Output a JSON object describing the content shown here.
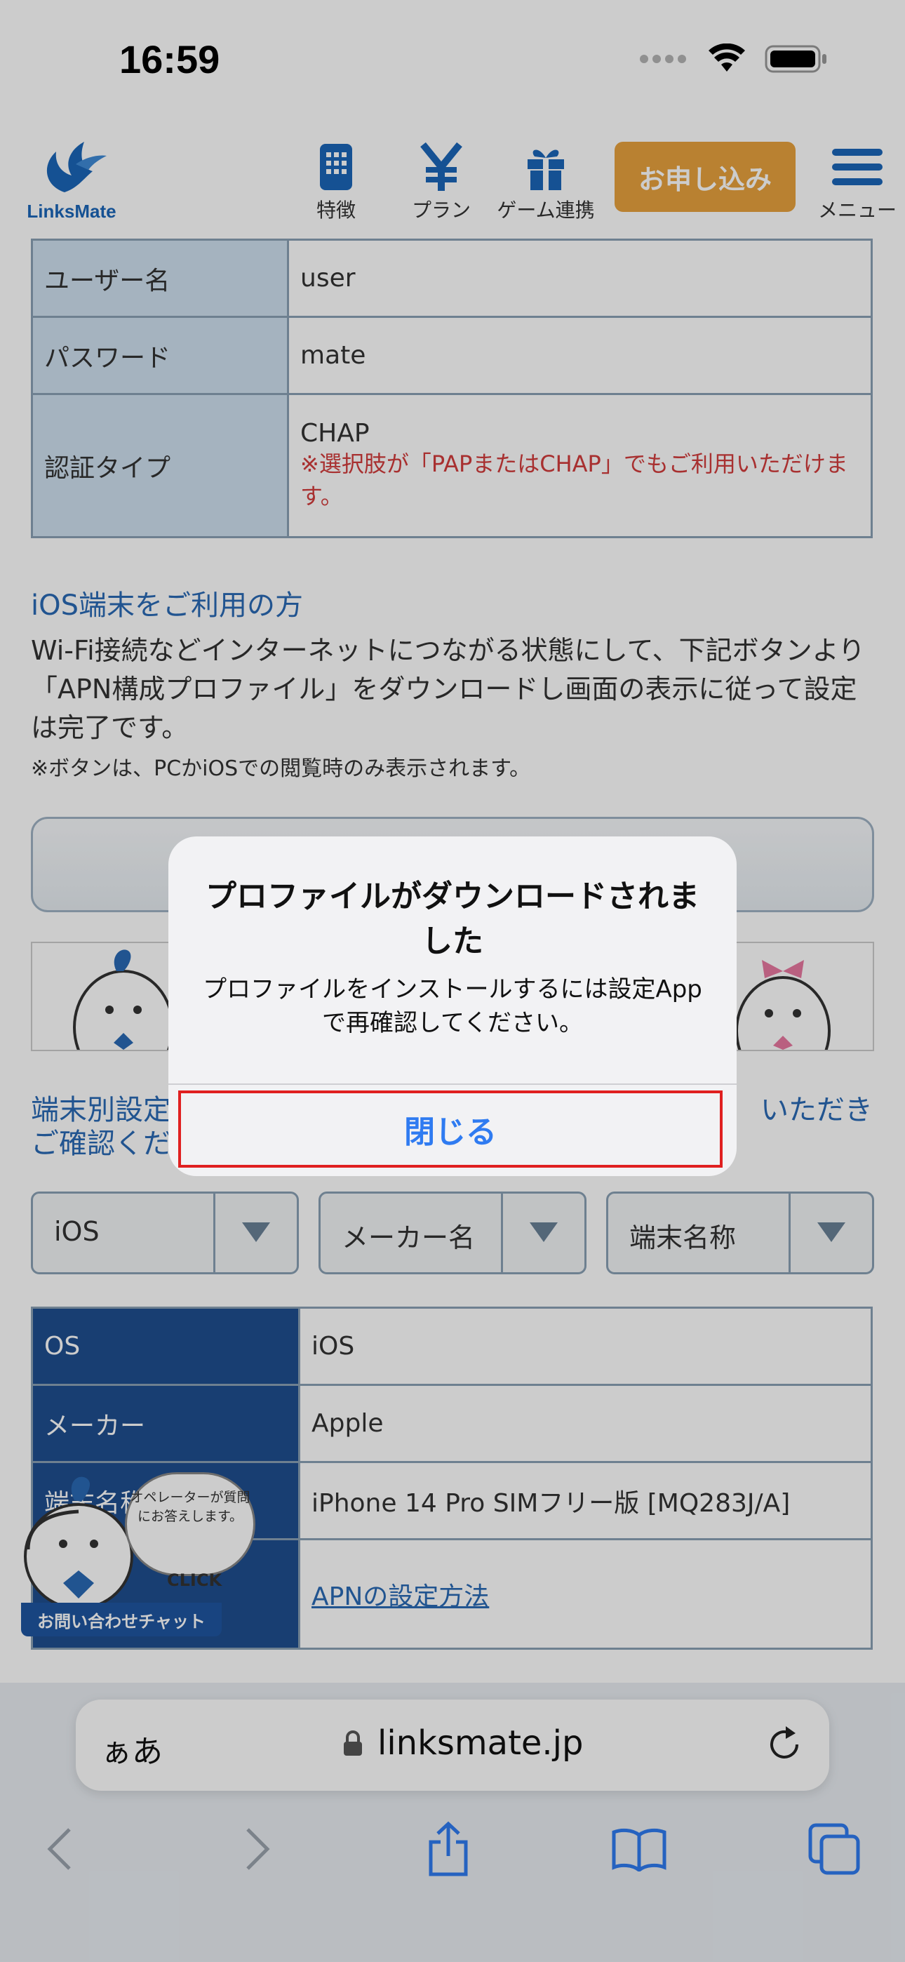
{
  "status": {
    "time": "16:59"
  },
  "header": {
    "logo_text": "LinksMate",
    "nav": [
      {
        "label": "特徴",
        "icon": "phone-icon"
      },
      {
        "label": "プラン",
        "icon": "yen-icon"
      },
      {
        "label": "ゲーム連携",
        "icon": "gift-icon"
      }
    ],
    "apply_label": "お申し込み",
    "menu_label": "メニュー"
  },
  "apn_table": {
    "rows": [
      {
        "label": "ユーザー名",
        "value": "user"
      },
      {
        "label": "パスワード",
        "value": "mate"
      },
      {
        "label": "認証タイプ",
        "value": "CHAP",
        "note": "※選択肢が「PAPまたはCHAP」でもご利用いただけます。"
      }
    ]
  },
  "ios_section": {
    "title": "iOS端末をご利用の方",
    "body": "Wi-Fi接続などインターネットにつながる状態にして、下記ボタンより「APN構成プロファイル」をダウンロードし画面の表示に従って設定は完了です。",
    "note": "※ボタンは、PCかiOSでの閲覧時のみ表示されます。"
  },
  "device_section": {
    "title_left": "端末別設定",
    "title_right": "いただき",
    "title_line2": "ご確認くだ"
  },
  "selects": [
    {
      "value": "iOS"
    },
    {
      "value": "メーカー名"
    },
    {
      "value": "端末名称"
    }
  ],
  "device_table": {
    "rows": [
      {
        "label": "OS",
        "value": "iOS"
      },
      {
        "label": "メーカー",
        "value": "Apple"
      },
      {
        "label": "端末名称",
        "value": "iPhone 14 Pro SIMフリー版 [MQ283J/A]"
      },
      {
        "label": "",
        "value": "APNの設定方法",
        "link": true
      }
    ]
  },
  "chat": {
    "bubble": "オペレーターが質問にお答えします。",
    "click": "CLICK",
    "label": "お問い合わせチャット"
  },
  "alert": {
    "title": "プロファイルがダウンロードされました",
    "message": "プロファイルをインストールするには設定Appで再確認してください。",
    "close_label": "閉じる"
  },
  "safari": {
    "aa_label": "ぁあ",
    "url": "linksmate.jp"
  },
  "colors": {
    "accent_blue": "#2a6ab4",
    "apply_orange": "#e8a23e",
    "table_dark": "#1f4e8f",
    "table_light": "#cfe0ef",
    "alert_button": "#2f7bf1",
    "highlight_red": "#e02020"
  }
}
